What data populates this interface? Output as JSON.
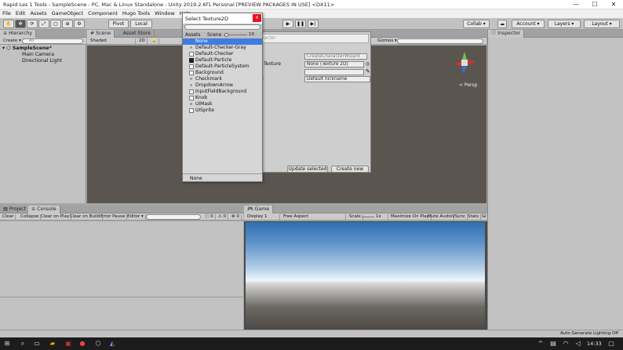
{
  "window": {
    "title": "Rapid Les 1 Tools - SampleScene - PC, Mac & Linux Standalone - Unity 2019.2.6f1 Personal [PREVIEW PACKAGES IN USE] <DX11>",
    "minimize": "—",
    "maximize": "☐",
    "close": "✕"
  },
  "menu": [
    "File",
    "Edit",
    "Assets",
    "GameObject",
    "Component",
    "Hugo Tools",
    "Window",
    "Help"
  ],
  "toolbar": {
    "pivot": "Pivot",
    "local": "Local",
    "collab": "Collab ▾",
    "account": "Account ▾",
    "layers": "Layers ▾",
    "layout": "Layout ▾"
  },
  "hierarchy": {
    "tab": "Hierarchy",
    "create": "Create ▾",
    "search_placeholder": "All",
    "scene": "SampleScene*",
    "items": [
      "Main Camera",
      "Directional Light"
    ]
  },
  "scene": {
    "tab_scene": "Scene",
    "tab_asset_store": "Asset Store",
    "shaded": "Shaded",
    "mode_2d": "2D",
    "gizmos": "Gizmos ▾",
    "persp": "< Persp"
  },
  "dialog": {
    "title": "Select Texture2D",
    "close": "x",
    "search_value": "",
    "tab_assets": "Assets",
    "tab_scene": "Scene",
    "slider_value": "10",
    "items": [
      {
        "label": "None",
        "selected": true,
        "swatch": "none"
      },
      {
        "label": "Default-Checker-Gray",
        "selected": false,
        "swatch": "dot"
      },
      {
        "label": "Default-Checker",
        "selected": false,
        "swatch": "white"
      },
      {
        "label": "Default-Particle",
        "selected": false,
        "swatch": "black"
      },
      {
        "label": "Default-ParticleSystem",
        "selected": false,
        "swatch": "white"
      },
      {
        "label": "Background",
        "selected": false,
        "swatch": "white"
      },
      {
        "label": "Checkmark",
        "selected": false,
        "swatch": "dot"
      },
      {
        "label": "DropdownArrow",
        "selected": false,
        "swatch": "dot"
      },
      {
        "label": "InputFieldBackground",
        "selected": false,
        "swatch": "white"
      },
      {
        "label": "Knob",
        "selected": false,
        "swatch": "white"
      },
      {
        "label": "UIMask",
        "selected": false,
        "swatch": "dot"
      },
      {
        "label": "UISprite",
        "selected": false,
        "swatch": "white"
      }
    ],
    "footer": "None"
  },
  "create_character": {
    "header_fragment": "Character",
    "script_field": "CreateCharacterWizard",
    "texture_label": "Texture",
    "texture_value": "None (Texture 2D)",
    "color_value": "",
    "name_label_fragment": "e",
    "name_value": "Default nickname",
    "update_button": "Update selected",
    "create_button": "Create new"
  },
  "inspector": {
    "tab": "Inspector"
  },
  "console": {
    "tab_project": "Project",
    "tab_console": "Console",
    "clear": "Clear",
    "collapse": "Collapse",
    "clear_on_play": "Clear on Play",
    "clear_on_build": "Clear on Build",
    "error_pause": "Error Pause",
    "editor": "Editor ▾",
    "count_log": "0",
    "count_warn": "0",
    "count_err": "0"
  },
  "game": {
    "tab": "Game",
    "display": "Display 1",
    "aspect": "Free Aspect",
    "scale_label": "Scale",
    "scale_value": "1x",
    "maximize_on_play": "Maximize On Play",
    "mute_audio": "Mute Audio",
    "vsync": "VSync",
    "stats": "Stats",
    "gizmos": "Gi"
  },
  "status": {
    "right": "Auto Generate Lighting Off"
  },
  "taskbar": {
    "time": "14:33"
  }
}
